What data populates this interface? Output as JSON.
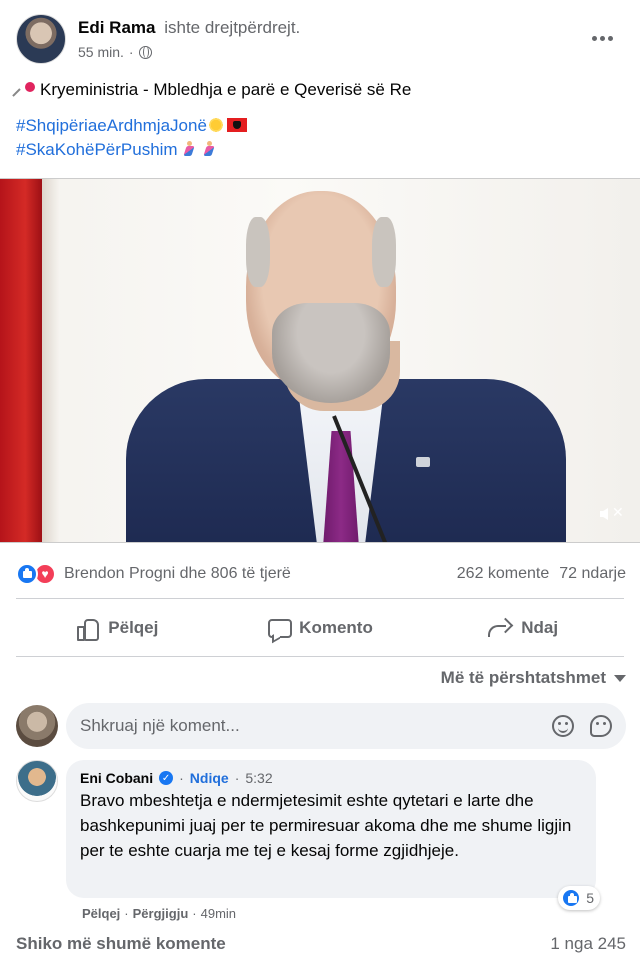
{
  "post": {
    "author": "Edi Rama",
    "status": "ishte drejtpërdrejt.",
    "time": "55 min.",
    "privacy_icon": "globe-icon",
    "title_text": "Kryeministria - Mbledhja e parë e Qeverisë së Re",
    "hashtag1": "#ShqipëriaeArdhmjaJonë",
    "hashtag2": "#SkaKohëPërPushim",
    "more_icon": "more-options-icon"
  },
  "video": {
    "mute_icon": "speaker-muted-icon"
  },
  "stats": {
    "reactors": "Brendon Progni dhe 806 të tjerë",
    "comments": "262 komente",
    "shares": "72 ndarje",
    "reaction_icons": [
      "like-icon",
      "love-icon"
    ]
  },
  "actions": {
    "like": "Pëlqej",
    "comment": "Komento",
    "share": "Ndaj"
  },
  "sort": {
    "label": "Më të përshtatshmet"
  },
  "composer": {
    "placeholder": "Shkruaj një koment..."
  },
  "comment": {
    "author": "Eni Cobani",
    "follow": "Ndiqe",
    "time": "5:32",
    "body": "Bravo mbeshtetja e ndermjetesimit eshte qytetari e larte dhe bashkepunimi juaj per te permiresuar akoma dhe me shume ligjin per te eshte cuarja me tej e kesaj forme zgjidhjeje.",
    "like_count": "5",
    "like_label": "Pëlqej",
    "reply_label": "Përgjigju",
    "age": "49min"
  },
  "footer": {
    "more_comments": "Shiko më shumë komente",
    "pagination": "1 nga 245"
  },
  "colors": {
    "link": "#216fdb",
    "like_blue": "#1877f2",
    "love_red": "#f33e58",
    "muted_text": "#65676b",
    "bubble_bg": "#f0f2f5"
  }
}
